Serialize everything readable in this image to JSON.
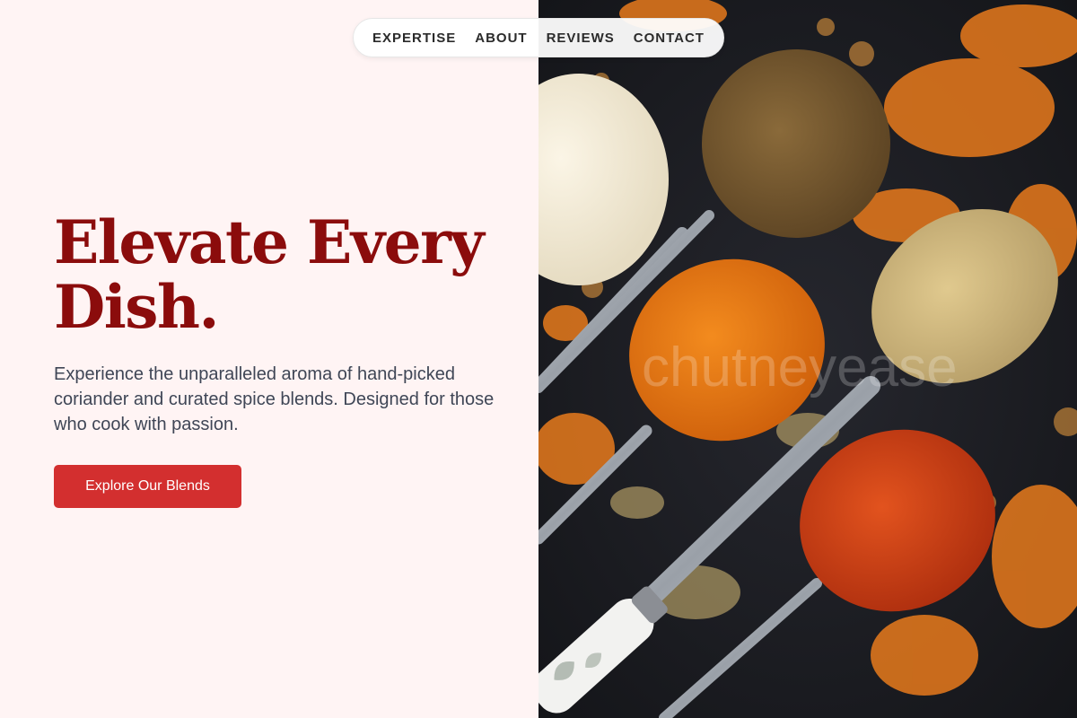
{
  "nav": {
    "links": [
      "EXPERTISE",
      "ABOUT",
      "REVIEWS",
      "CONTACT"
    ]
  },
  "hero": {
    "title_line1": "Elevate Every",
    "title_line2": "Dish.",
    "description": "Experience the unparalleled aroma of hand-picked coriander and curated spice blends. Designed for those who cook with passion.",
    "cta_label": "Explore Our Blends"
  },
  "image": {
    "watermark": "chutneyease",
    "subject": "spice-spoons-photo"
  },
  "colors": {
    "background": "#fff4f4",
    "title": "#8b0c0c",
    "body_text": "#3f4656",
    "accent": "#d32f2f"
  }
}
